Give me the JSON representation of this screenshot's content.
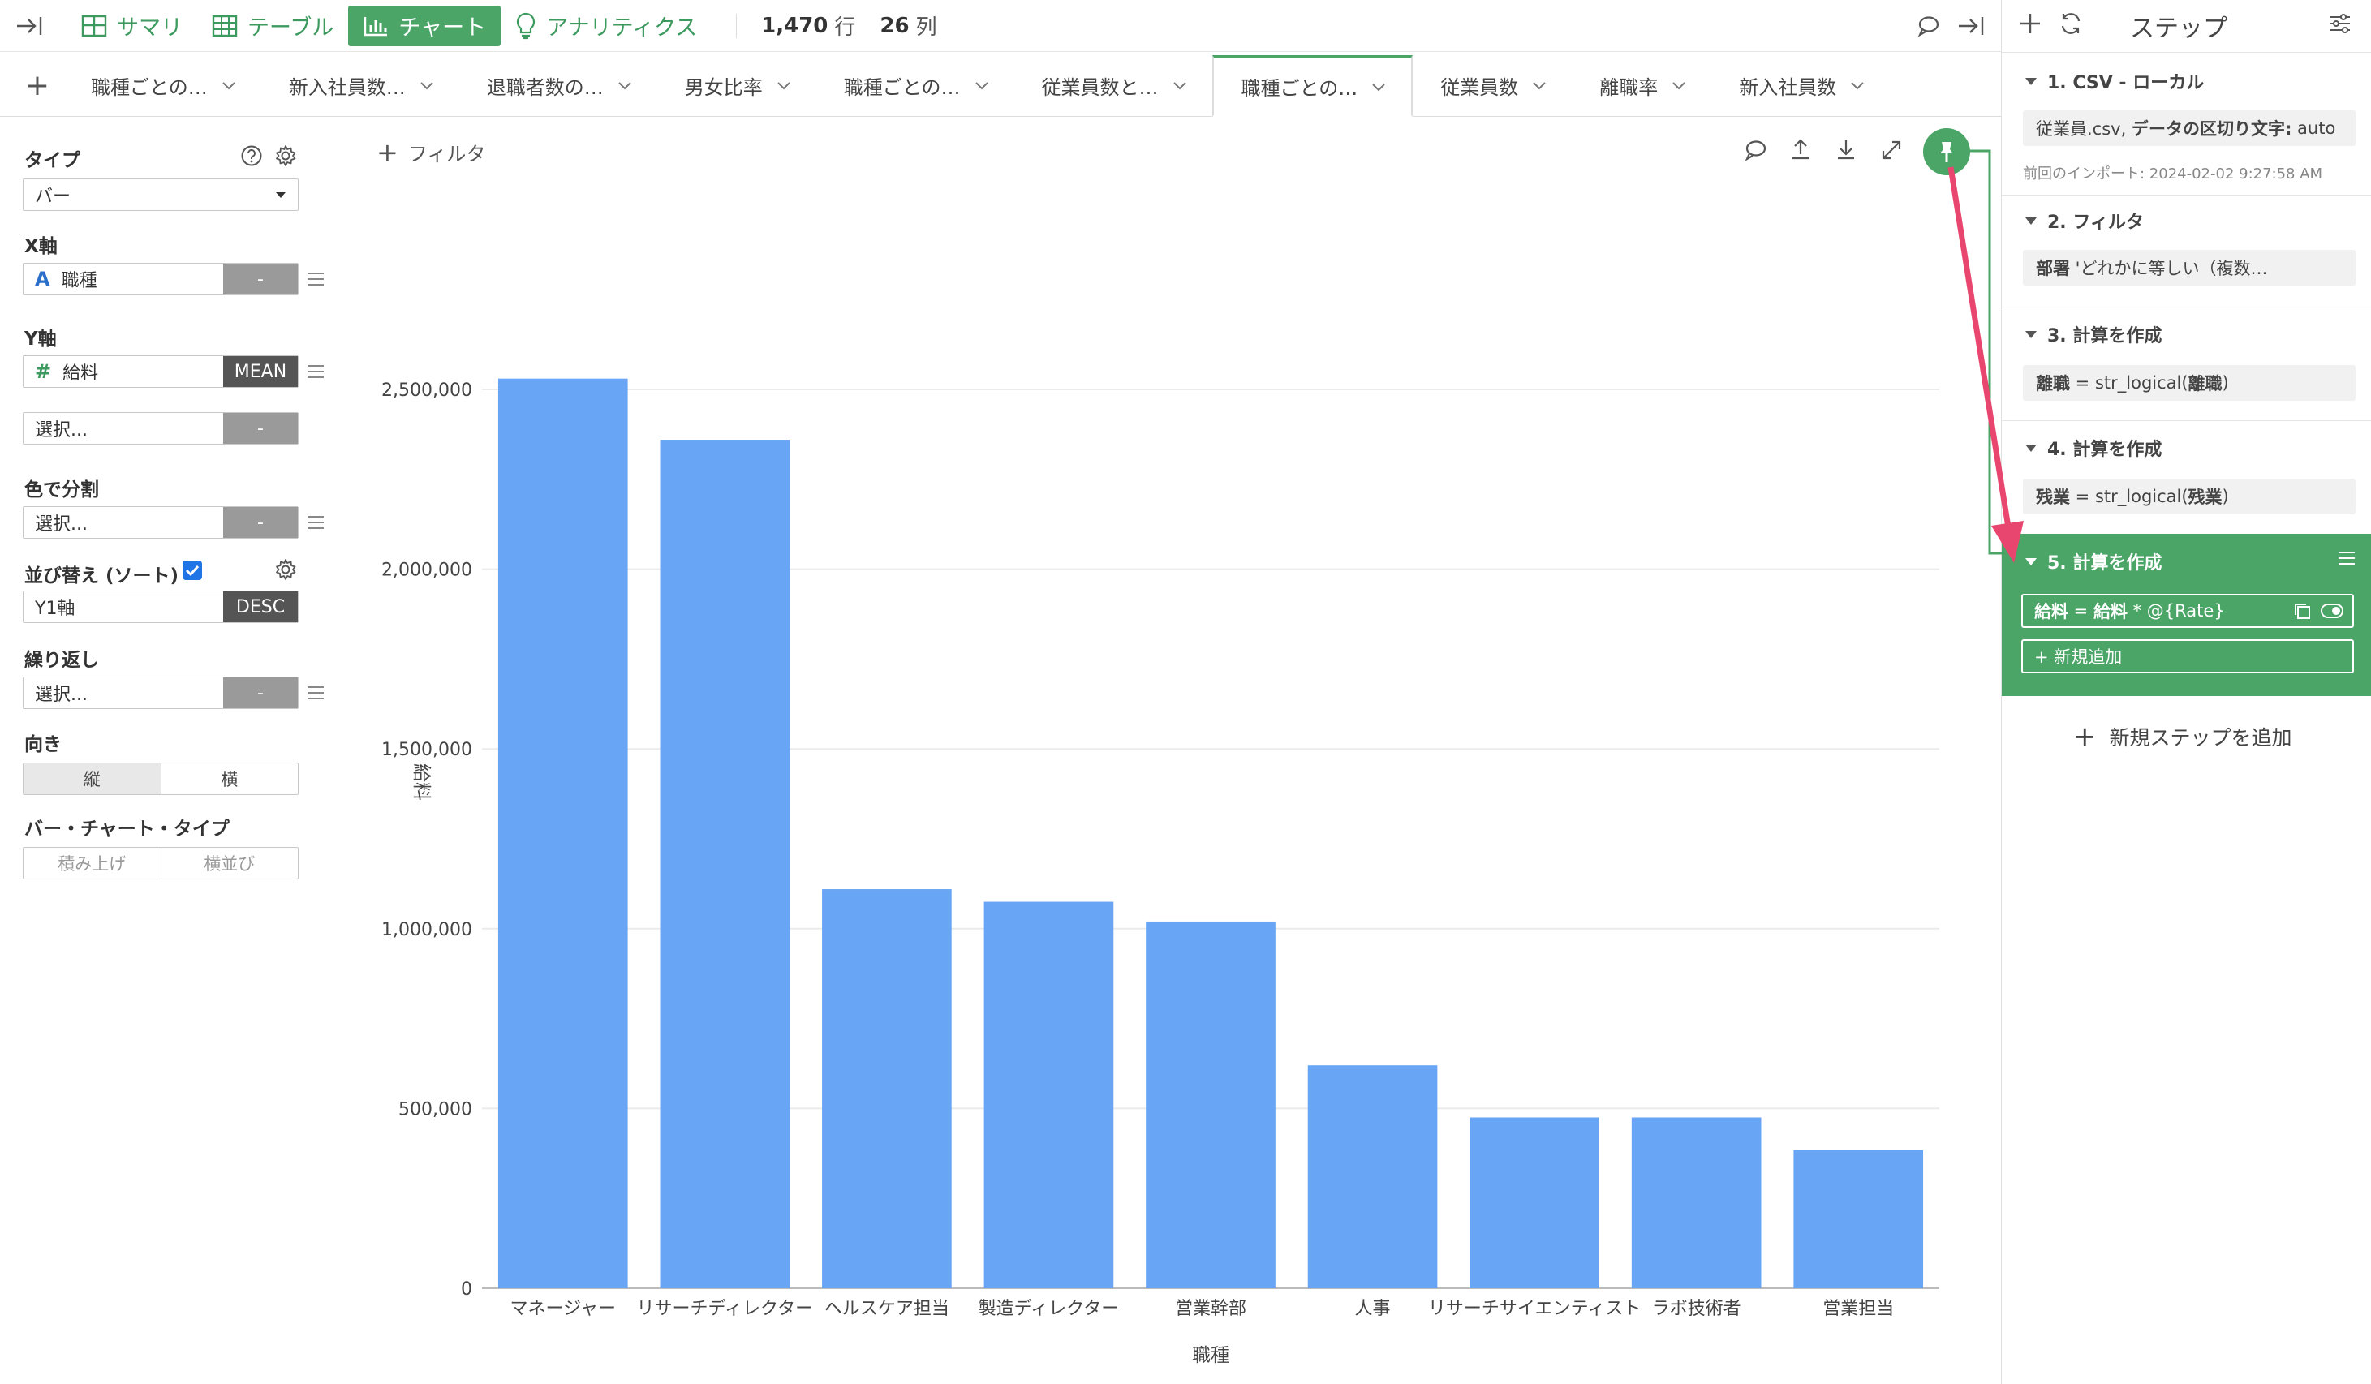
{
  "toolbar": {
    "summary": "サマリ",
    "table": "テーブル",
    "chart": "チャート",
    "analytics": "アナリティクス",
    "rows_count": "1,470",
    "rows_unit": "行",
    "cols_count": "26",
    "cols_unit": "列"
  },
  "tabs": [
    {
      "label": "職種ごとの…",
      "active": false
    },
    {
      "label": "新入社員数…",
      "active": false
    },
    {
      "label": "退職者数の…",
      "active": false
    },
    {
      "label": "男女比率",
      "active": false
    },
    {
      "label": "職種ごとの…",
      "active": false
    },
    {
      "label": "従業員数と…",
      "active": false
    },
    {
      "label": "職種ごとの…",
      "active": true
    },
    {
      "label": "従業員数",
      "active": false
    },
    {
      "label": "離職率",
      "active": false
    },
    {
      "label": "新入社員数",
      "active": false
    }
  ],
  "settings": {
    "type_label": "タイプ",
    "type_value": "バー",
    "x_label": "X軸",
    "x_field": "職種",
    "x_agg": "-",
    "y_label": "Y軸",
    "y_field": "給料",
    "y_agg": "MEAN",
    "y2_placeholder": "選択...",
    "y2_agg": "-",
    "color_label": "色で分割",
    "color_placeholder": "選択...",
    "color_agg": "-",
    "sort_label": "並び替え (ソート)",
    "sort_checked": true,
    "sort_field": "Y1軸",
    "sort_order": "DESC",
    "repeat_label": "繰り返し",
    "repeat_placeholder": "選択...",
    "repeat_agg": "-",
    "orientation_label": "向き",
    "orientation_vertical": "縦",
    "orientation_horizontal": "横",
    "bar_type_label": "バー・チャート・タイプ",
    "bar_type_stacked": "積み上げ",
    "bar_type_side": "横並び"
  },
  "filter": {
    "label": "フィルタ"
  },
  "chart_data": {
    "type": "bar",
    "categories": [
      "マネージャー",
      "リサーチディレクター",
      "ヘルスケア担当",
      "製造ディレクター",
      "営業幹部",
      "人事",
      "リサーチサイエンティスト",
      "ラボ技術者",
      "営業担当"
    ],
    "values": [
      2530000,
      2360000,
      1110000,
      1075000,
      1020000,
      620000,
      475000,
      475000,
      385000
    ],
    "xlabel": "職種",
    "ylabel": "給料",
    "ylim": [
      0,
      2500000
    ],
    "yticks": [
      0,
      500000,
      1000000,
      1500000,
      2000000,
      2500000
    ],
    "ytick_labels": [
      "0",
      "500,000",
      "1,000,000",
      "1,500,000",
      "2,000,000",
      "2,500,000"
    ],
    "bar_color": "#68a5f4",
    "grid": true
  },
  "steps_panel": {
    "title": "ステップ",
    "steps": [
      {
        "header": "1. CSV - ローカル",
        "body_pre": "従業員.csv, ",
        "body_bold": "データの区切り文字:",
        "body_post": " auto",
        "note": "前回のインポート: 2024-02-02 9:27:58 AM"
      },
      {
        "header": "2. フィルタ",
        "body_bold": "部署",
        "body_post": " 'どれかに等しい（複数…"
      },
      {
        "header": "3. 計算を作成",
        "body_bold": "離職",
        "body_mid": " = str_logical(",
        "body_bold2": "離職",
        "body_post": ")"
      },
      {
        "header": "4. 計算を作成",
        "body_bold": "残業",
        "body_mid": " = str_logical(",
        "body_bold2": "残業",
        "body_post": ")"
      },
      {
        "header": "5. 計算を作成",
        "body_bold": "給料",
        "body_mid": " = ",
        "body_bold2": "給料",
        "body_post": " * @{Rate}",
        "add_new": "+ 新規追加"
      }
    ],
    "add_step": "新規ステップを追加"
  },
  "colors": {
    "accent": "#4aa567",
    "bar": "#68a5f4",
    "annotation_arrow": "#e8466e"
  }
}
